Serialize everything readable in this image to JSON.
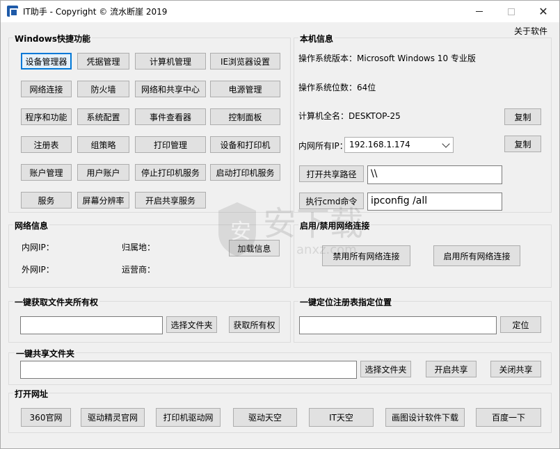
{
  "window": {
    "title": "IT助手 - Copyright © 流水断崖 2019",
    "about": "关于软件"
  },
  "windows_shortcuts": {
    "title": "Windows快捷功能",
    "buttons": [
      "设备管理器",
      "凭据管理",
      "计算机管理",
      "IE浏览器设置",
      "网络连接",
      "防火墙",
      "网络和共享中心",
      "电源管理",
      "程序和功能",
      "系统配置",
      "事件查看器",
      "控制面板",
      "注册表",
      "组策略",
      "打印管理",
      "设备和打印机",
      "账户管理",
      "用户账户",
      "停止打印机服务",
      "启动打印机服务",
      "服务",
      "屏幕分辨率",
      "开启共享服务"
    ]
  },
  "local_info": {
    "title": "本机信息",
    "os_version": "操作系统版本：Microsoft Windows 10 专业版",
    "os_bits": "操作系统位数：64位",
    "computer_name": "计算机全名：DESKTOP-25",
    "copy_label": "复制",
    "ip_label": "内网所有IP：",
    "ip_selected": "192.168.1.174",
    "open_share_label": "打开共享路径",
    "share_path": "\\\\",
    "run_cmd_label": "执行cmd命令",
    "cmd_value": "ipconfig /all"
  },
  "network_info": {
    "title": "网络信息",
    "lan_ip": "内网IP：",
    "wan_ip": "外网IP：",
    "location": "归属地：",
    "isp": "运营商：",
    "load_label": "加载信息"
  },
  "net_toggle": {
    "title": "启用/禁用网络连接",
    "disable_label": "禁用所有网络连接",
    "enable_label": "启用所有网络连接"
  },
  "folder_owner": {
    "title": "一键获取文件夹所有权",
    "path": "",
    "choose_label": "选择文件夹",
    "take_label": "获取所有权"
  },
  "registry_locate": {
    "title": "一键定位注册表指定位置",
    "path": "",
    "locate_label": "定位"
  },
  "share_folder": {
    "title": "一键共享文件夹",
    "path": "",
    "choose_label": "选择文件夹",
    "open_label": "开启共享",
    "close_label": "关闭共享"
  },
  "open_urls": {
    "title": "打开网址",
    "buttons": [
      "360官网",
      "驱动精灵官网",
      "打印机驱动网",
      "驱动天空",
      "IT天空",
      "画图设计软件下载",
      "百度一下"
    ]
  },
  "watermark": {
    "text": "安下载",
    "domain": "anxz.com"
  }
}
